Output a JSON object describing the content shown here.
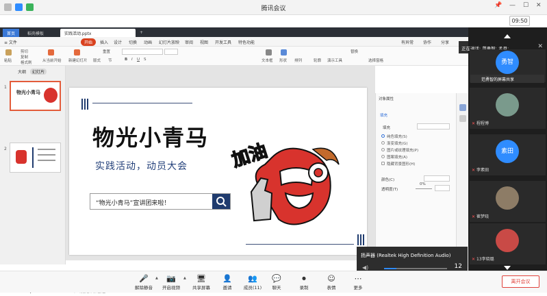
{
  "window": {
    "title": "腾讯会议",
    "clock": "09:50"
  },
  "ppt": {
    "tabs": [
      {
        "label": "首页"
      },
      {
        "label": "稻壳模板"
      },
      {
        "label": "实践活动.pptx"
      }
    ],
    "menu": [
      "开始",
      "插入",
      "设计",
      "切换",
      "动画",
      "幻灯片放映",
      "审阅",
      "视图",
      "开发工具",
      "特色功能"
    ],
    "menu_right": [
      "有异常",
      "协作",
      "分享"
    ],
    "ribbon_labels": [
      "粘贴",
      "剪切",
      "复制",
      "格式刷",
      "从当前开始",
      "新建幻灯片",
      "版式",
      "节",
      "重置",
      "文本框",
      "形状",
      "排列",
      "轮廓",
      "替换",
      "选择窗格",
      "演示工具"
    ],
    "font_name": "",
    "thumbs_head": [
      "大纲",
      "幻灯片"
    ],
    "slide_numbers": [
      "1",
      "2"
    ],
    "notes_placeholder": "单击此处添加备注",
    "add_slide": "+"
  },
  "slide": {
    "title": "物光小青马",
    "subtitle": "实践活动，动员大会",
    "search_text": "“物光小青马”宣讲团来啦！",
    "mascot_text": "加油"
  },
  "props": {
    "header": "对象属性",
    "tab": "填充",
    "section": "填充",
    "options": [
      "纯色填充(S)",
      "渐变填充(G)",
      "图片或纹理填充(P)",
      "图案填充(A)",
      "隐藏背景图形(H)"
    ],
    "color_label": "颜色(C)",
    "transparency_label": "透明度(T)",
    "transparency_value": "0%"
  },
  "speaker": {
    "label": "扬声器 (Realtek High Definition Audio)",
    "volume": 12,
    "volume_fraction": 0.2
  },
  "meeting": {
    "notice": "正在讲话: 范勇智; 孟月;",
    "notice_close": "✕",
    "share_label": "范勇智的屏幕共享",
    "participants": [
      {
        "avatar": "勇智",
        "name": "",
        "color": "#2f8cff"
      },
      {
        "avatar": "",
        "name": "程程博",
        "color": "#7a9a8c"
      },
      {
        "avatar": "素田",
        "name": "李素田",
        "color": "#2f8cff"
      },
      {
        "avatar": "",
        "name": "崔梦晓",
        "color": "#8d7c66"
      },
      {
        "avatar": "",
        "name": "13李晓璐",
        "color": "#c94a46"
      }
    ]
  },
  "toolbar": {
    "items": [
      {
        "label": "解除静音",
        "icon": "🎤"
      },
      {
        "label": "开启视频",
        "icon": "📷"
      },
      {
        "label": "共享屏幕",
        "icon": "🖥"
      },
      {
        "label": "邀请",
        "icon": "👤"
      },
      {
        "label": "成员(11)",
        "icon": "👥"
      },
      {
        "label": "聊天",
        "icon": "💬"
      },
      {
        "label": "录制",
        "icon": "⏺"
      },
      {
        "label": "表情",
        "icon": "☺"
      },
      {
        "label": "更多",
        "icon": "⋯"
      }
    ],
    "leave_label": "离开会议"
  }
}
